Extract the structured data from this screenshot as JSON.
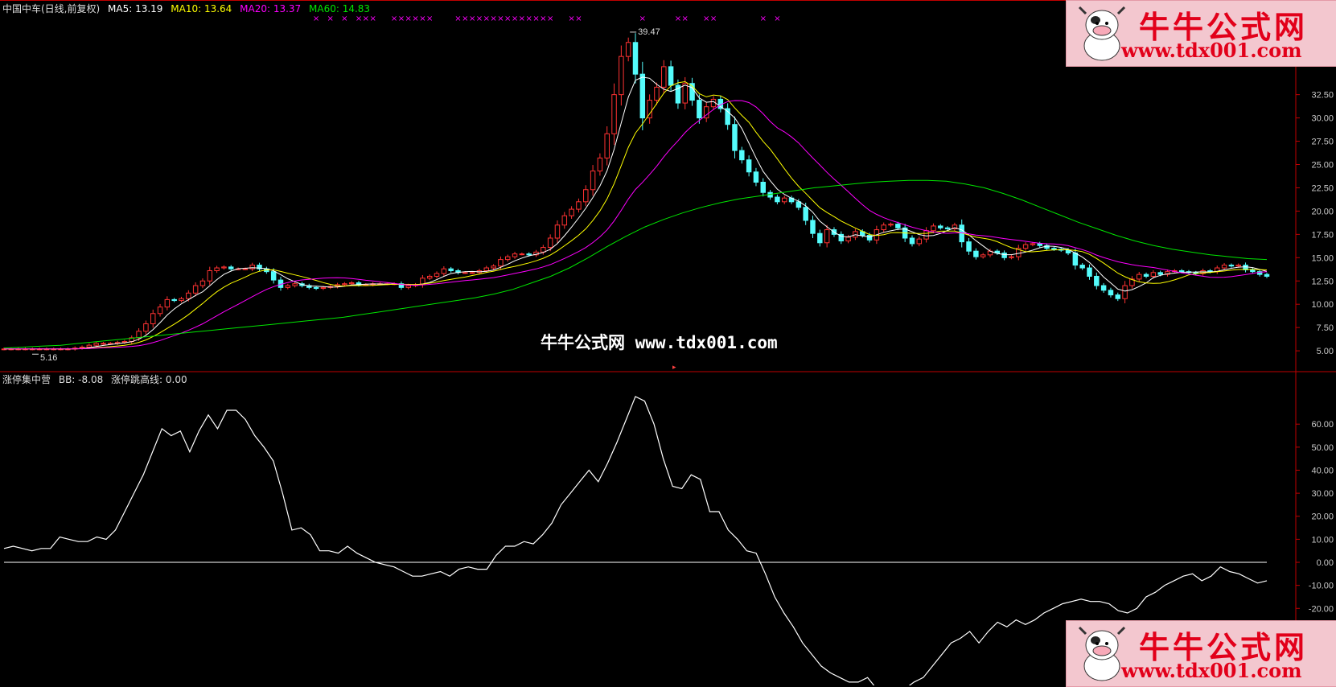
{
  "header": {
    "name": "中国中车(日线,前复权)",
    "ma5": "MA5: 13.19",
    "ma10": "MA10: 13.64",
    "ma20": "MA20: 13.37",
    "ma60": "MA60: 14.83"
  },
  "indicator_header": {
    "name": "涨停集中营",
    "bb": "BB: -8.08",
    "line": "涨停跳高线: 0.00"
  },
  "watermark": "牛牛公式网 www.tdx001.com",
  "logo": {
    "title": "牛牛公式网",
    "url": "www.tdx001.com"
  },
  "colors": {
    "up": "#ff3232",
    "down": "#54fcfc",
    "ma5": "#ffffff",
    "ma10": "#ffff00",
    "ma20": "#ff00ff",
    "ma60": "#00e600",
    "mark": "#ff00ff",
    "grid": "#800000",
    "axis": "#c00000"
  },
  "chart_data": [
    {
      "type": "candlestick",
      "title": "中国中车(日线,前复权)",
      "ylim": [
        3.8,
        40.5
      ],
      "yticks": [
        "5.00",
        "7.50",
        "10.00",
        "12.50",
        "15.00",
        "17.50",
        "20.00",
        "22.50",
        "25.00",
        "27.50",
        "30.00",
        "32.50"
      ],
      "annotations": {
        "high_label": "39.47",
        "low_label": "5.16"
      },
      "close": [
        5.2,
        5.2,
        5.2,
        5.2,
        5.2,
        5.2,
        5.2,
        5.2,
        5.2,
        5.2,
        5.3,
        5.4,
        5.6,
        5.8,
        5.8,
        5.8,
        5.9,
        6.0,
        6.4,
        7.1,
        7.9,
        9.0,
        9.7,
        10.5,
        10.4,
        10.6,
        11.2,
        12.0,
        12.5,
        13.6,
        13.9,
        14.0,
        13.8,
        13.8,
        13.8,
        14.2,
        13.8,
        13.5,
        12.6,
        11.8,
        12.0,
        12.2,
        12.0,
        11.8,
        11.7,
        11.8,
        11.9,
        12.1,
        12.2,
        12.3,
        12.1,
        12.1,
        12.2,
        12.2,
        12.2,
        12.2,
        11.8,
        12.0,
        12.1,
        12.8,
        13.0,
        13.3,
        13.8,
        13.6,
        13.4,
        13.4,
        13.4,
        13.6,
        13.9,
        14.1,
        14.8,
        15.1,
        15.4,
        15.4,
        15.3,
        15.6,
        16.1,
        17.1,
        18.5,
        19.5,
        20.2,
        21.0,
        22.3,
        24.3,
        25.7,
        28.3,
        32.5,
        36.6,
        38.1,
        34.7,
        30.0,
        31.9,
        33.3,
        35.5,
        33.5,
        31.6,
        33.7,
        31.9,
        30.0,
        31.2,
        32.0,
        31.0,
        29.3,
        26.5,
        25.5,
        24.2,
        23.1,
        22.0,
        21.5,
        21.0,
        21.4,
        21.0,
        20.4,
        19.0,
        17.6,
        16.6,
        18.0,
        17.5,
        16.8,
        17.2,
        17.8,
        17.4,
        16.9,
        18.0,
        18.5,
        18.6,
        18.2,
        17.1,
        16.5,
        17.0,
        17.9,
        18.4,
        18.2,
        18.1,
        18.5,
        16.7,
        15.7,
        15.1,
        15.3,
        15.7,
        15.5,
        15.0,
        15.1,
        16.0,
        16.4,
        16.5,
        16.3,
        16.0,
        15.9,
        15.8,
        15.5,
        14.2,
        13.9,
        13.0,
        12.0,
        11.5,
        11.0,
        10.6,
        12.0,
        12.7,
        13.2,
        13.0,
        13.4,
        13.2,
        13.5,
        13.6,
        13.5,
        13.4,
        13.3,
        13.6,
        13.5,
        13.9,
        14.2,
        14.1,
        14.2,
        13.7,
        13.5,
        13.2,
        13.0
      ],
      "ma20": [
        5.2,
        5.2,
        5.2,
        5.2,
        5.2,
        5.2,
        5.2,
        5.2,
        5.2,
        5.2,
        5.2,
        5.3,
        5.3,
        5.3,
        5.4,
        5.5,
        5.6,
        5.7,
        5.9,
        6.2,
        6.6,
        7.1,
        7.7,
        8.3,
        8.9,
        9.5,
        10.1,
        10.6,
        11.0,
        11.5,
        12.0,
        12.4,
        12.6,
        12.7,
        12.8,
        12.8,
        12.8,
        12.7,
        12.6,
        12.5,
        12.4,
        12.4,
        12.3,
        12.3,
        12.2,
        12.2,
        12.2,
        12.2,
        12.2,
        12.2,
        12.3,
        12.4,
        12.5,
        12.6,
        12.8,
        13.1,
        13.4,
        13.8,
        14.3,
        14.9,
        15.5,
        16.2,
        16.9,
        17.7,
        18.7,
        19.9,
        21.2,
        22.5,
        23.9,
        25.2,
        26.5,
        27.6,
        28.6,
        29.4,
        30.1,
        30.7,
        31.0,
        31.2,
        31.2,
        31.0,
        30.6,
        30.1,
        29.4,
        28.7,
        27.8,
        26.9,
        26.0,
        25.1,
        24.3,
        23.5,
        22.8,
        22.1,
        21.5,
        20.9,
        20.4,
        19.9,
        19.4,
        19.0,
        18.6,
        18.2,
        17.9,
        17.7,
        17.5,
        17.4,
        17.3,
        17.2,
        17.1,
        17.0,
        16.9,
        16.8,
        16.7,
        16.6,
        16.5,
        16.4,
        16.3,
        16.2,
        16.0,
        15.8,
        15.6,
        15.3,
        15.0,
        14.7,
        14.3,
        14.0,
        13.7,
        13.4,
        13.2,
        13.0,
        12.9,
        12.9,
        13.0,
        13.1,
        13.2,
        13.3,
        13.4,
        13.4,
        13.4,
        13.4,
        13.4,
        13.4,
        13.4,
        13.4,
        13.4,
        13.4,
        13.4,
        13.4,
        13.4,
        13.4,
        13.4,
        13.4
      ],
      "ma20_note": "series sampled at uniform x over the candle range; first 35 points precede the later portion",
      "ma60": [
        5.3,
        5.4,
        5.5,
        5.6,
        5.8,
        6.0,
        6.2,
        6.4,
        6.6,
        6.8,
        7.0,
        7.2,
        7.4,
        7.6,
        7.8,
        8.0,
        8.2,
        8.4,
        8.6,
        8.9,
        9.2,
        9.5,
        9.8,
        10.1,
        10.4,
        10.7,
        11.1,
        11.6,
        12.3,
        13.0,
        13.9,
        15.0,
        16.2,
        17.3,
        18.3,
        19.1,
        19.8,
        20.4,
        20.9,
        21.3,
        21.6,
        21.9,
        22.2,
        22.5,
        22.7,
        22.9,
        23.1,
        23.2,
        23.3,
        23.3,
        23.2,
        22.9,
        22.5,
        21.9,
        21.2,
        20.4,
        19.6,
        18.8,
        18.1,
        17.4,
        16.8,
        16.3,
        15.9,
        15.6,
        15.3,
        15.1,
        14.9,
        14.8
      ],
      "limit_up_markers": [
        44,
        46,
        48,
        50,
        51,
        52,
        55,
        56,
        57,
        58,
        59,
        60,
        64,
        65,
        66,
        67,
        68,
        69,
        70,
        71,
        72,
        73,
        74,
        75,
        76,
        77,
        80,
        81,
        90,
        95,
        96,
        99,
        100,
        107,
        109
      ]
    },
    {
      "type": "line",
      "title": "涨停集中营",
      "series": [
        {
          "name": "BB",
          "values": [
            6,
            7,
            6,
            5,
            6,
            6,
            11,
            10,
            9,
            9,
            11,
            10,
            14,
            22,
            30,
            38,
            48,
            58,
            55,
            57,
            48,
            57,
            64,
            58,
            66,
            66,
            62,
            55,
            50,
            44,
            30,
            14,
            15,
            12,
            5,
            5,
            4,
            7,
            4,
            2,
            0,
            -1,
            -2,
            -4,
            -6,
            -6,
            -5,
            -4,
            -6,
            -3,
            -2,
            -3,
            -3,
            3,
            7,
            7,
            9,
            8,
            12,
            17,
            25,
            30,
            35,
            40,
            35,
            43,
            52,
            62,
            72,
            70,
            60,
            45,
            33,
            32,
            38,
            36,
            22,
            22,
            14,
            10,
            5,
            4,
            -5,
            -15,
            -22,
            -28,
            -35,
            -40,
            -45,
            -48,
            -50,
            -52,
            -52,
            -50,
            -55,
            -60,
            -58,
            -55,
            -52,
            -50,
            -45,
            -40,
            -35,
            -33,
            -30,
            -35,
            -30,
            -26,
            -28,
            -25,
            -27,
            -25,
            -22,
            -20,
            -18,
            -17,
            -16,
            -17,
            -17,
            -18,
            -21,
            -22,
            -20,
            -15,
            -13,
            -10,
            -8,
            -6,
            -5,
            -8,
            -6,
            -2,
            -4,
            -5,
            -7,
            -9,
            -8
          ]
        },
        {
          "name": "涨停跳高线",
          "values": [
            0,
            0
          ]
        }
      ],
      "ylim": [
        -22,
        73
      ],
      "yticks": [
        "60.00",
        "50.00",
        "40.00",
        "30.00",
        "20.00",
        "10.00",
        "0.00",
        "-10.00",
        "-20.00"
      ]
    }
  ]
}
